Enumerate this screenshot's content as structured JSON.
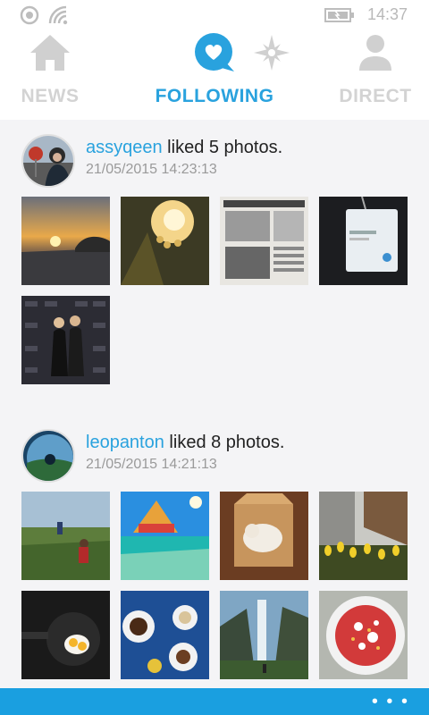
{
  "status_bar": {
    "time": "14:37",
    "icons": [
      "notification-icon",
      "wifi-icon",
      "battery-icon"
    ]
  },
  "pivot": {
    "tabs": [
      {
        "label": "NEWS",
        "icon": "home-icon",
        "active": false
      },
      {
        "label": "FOLLOWING",
        "icon": "heart-bubble-icon",
        "active": true
      },
      {
        "label": "",
        "icon": "compass-icon",
        "active": false
      },
      {
        "label": "DIRECT",
        "icon": "person-icon",
        "active": false
      }
    ]
  },
  "feed": [
    {
      "username": "assyqeen",
      "action": " liked 5 photos.",
      "timestamp": "21/05/2015 14:23:13",
      "photos": [
        "sunset-road",
        "flower-backlit",
        "newspaper-clipping",
        "id-lanyard",
        "spotify-event-photo"
      ]
    },
    {
      "username": "leopanton",
      "action": " liked 8 photos.",
      "timestamp": "21/05/2015 14:21:13",
      "photos": [
        "child-in-field",
        "underwater-beach",
        "cat-in-box",
        "tulips-building",
        "egg-in-pan",
        "coffee-cups",
        "waterfall",
        "red-dessert"
      ]
    }
  ],
  "app_bar": {
    "more_label": "• • •",
    "color": "#1a9fe0"
  },
  "accent_color": "#29a2de"
}
